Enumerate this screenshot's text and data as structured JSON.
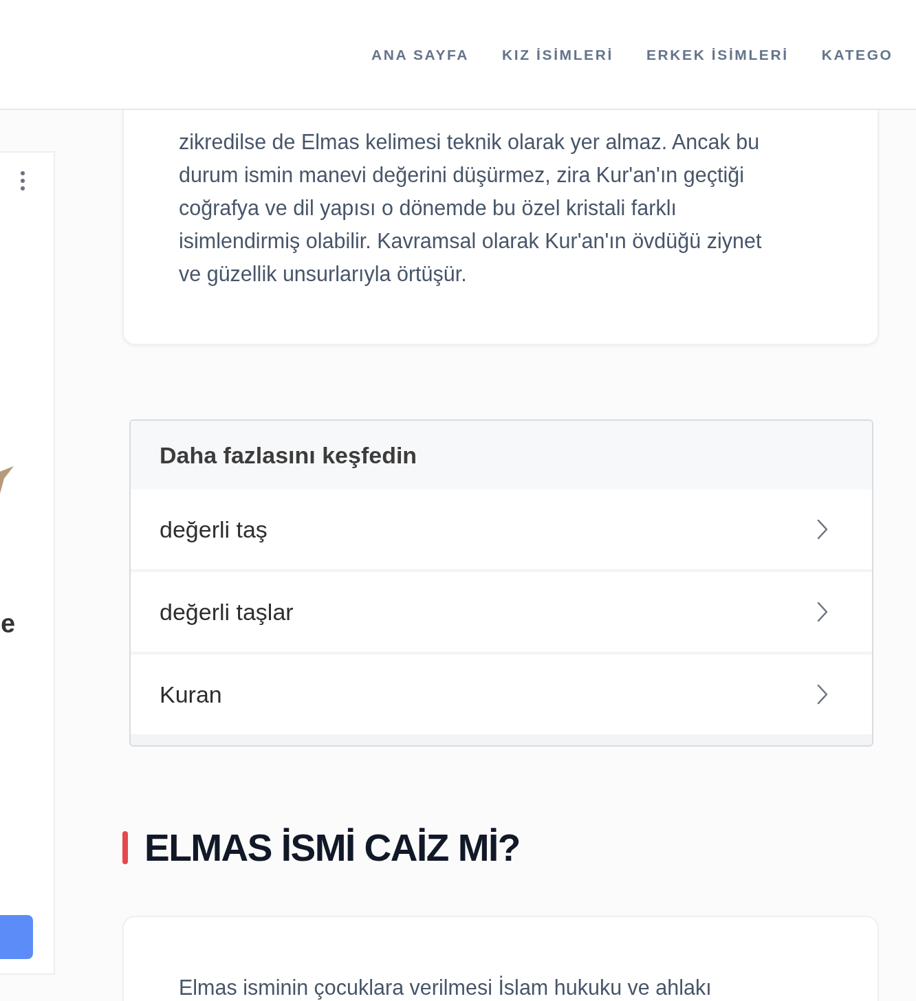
{
  "header": {
    "nav": [
      {
        "label": "ANA SAYFA"
      },
      {
        "label": "KIZ İSİMLERİ"
      },
      {
        "label": "ERKEK İSİMLERİ"
      },
      {
        "label": "KATEGO"
      }
    ]
  },
  "sidebar": {
    "heading_fragment": "e"
  },
  "article_card": {
    "paragraph": "zikredilse de Elmas kelimesi teknik olarak yer almaz. Ancak bu durum ismin manevi değerini düşürmez, zira Kur'an'ın geçtiği coğrafya ve dil yapısı o dönemde bu özel kristali farklı isimlendirmiş olabilir. Kavramsal olarak Kur'an'ın övdüğü ziynet ve güzellik unsurlarıyla örtüşür."
  },
  "explore": {
    "title": "Daha fazlasını keşfedin",
    "items": [
      {
        "label": "değerli taş"
      },
      {
        "label": "değerli taşlar"
      },
      {
        "label": "Kuran"
      }
    ]
  },
  "section_heading": "ELMAS İSMİ CAİZ Mİ?",
  "next_card": {
    "paragraph": "Elmas isminin çocuklara verilmesi İslam hukuku ve ahlakı"
  }
}
